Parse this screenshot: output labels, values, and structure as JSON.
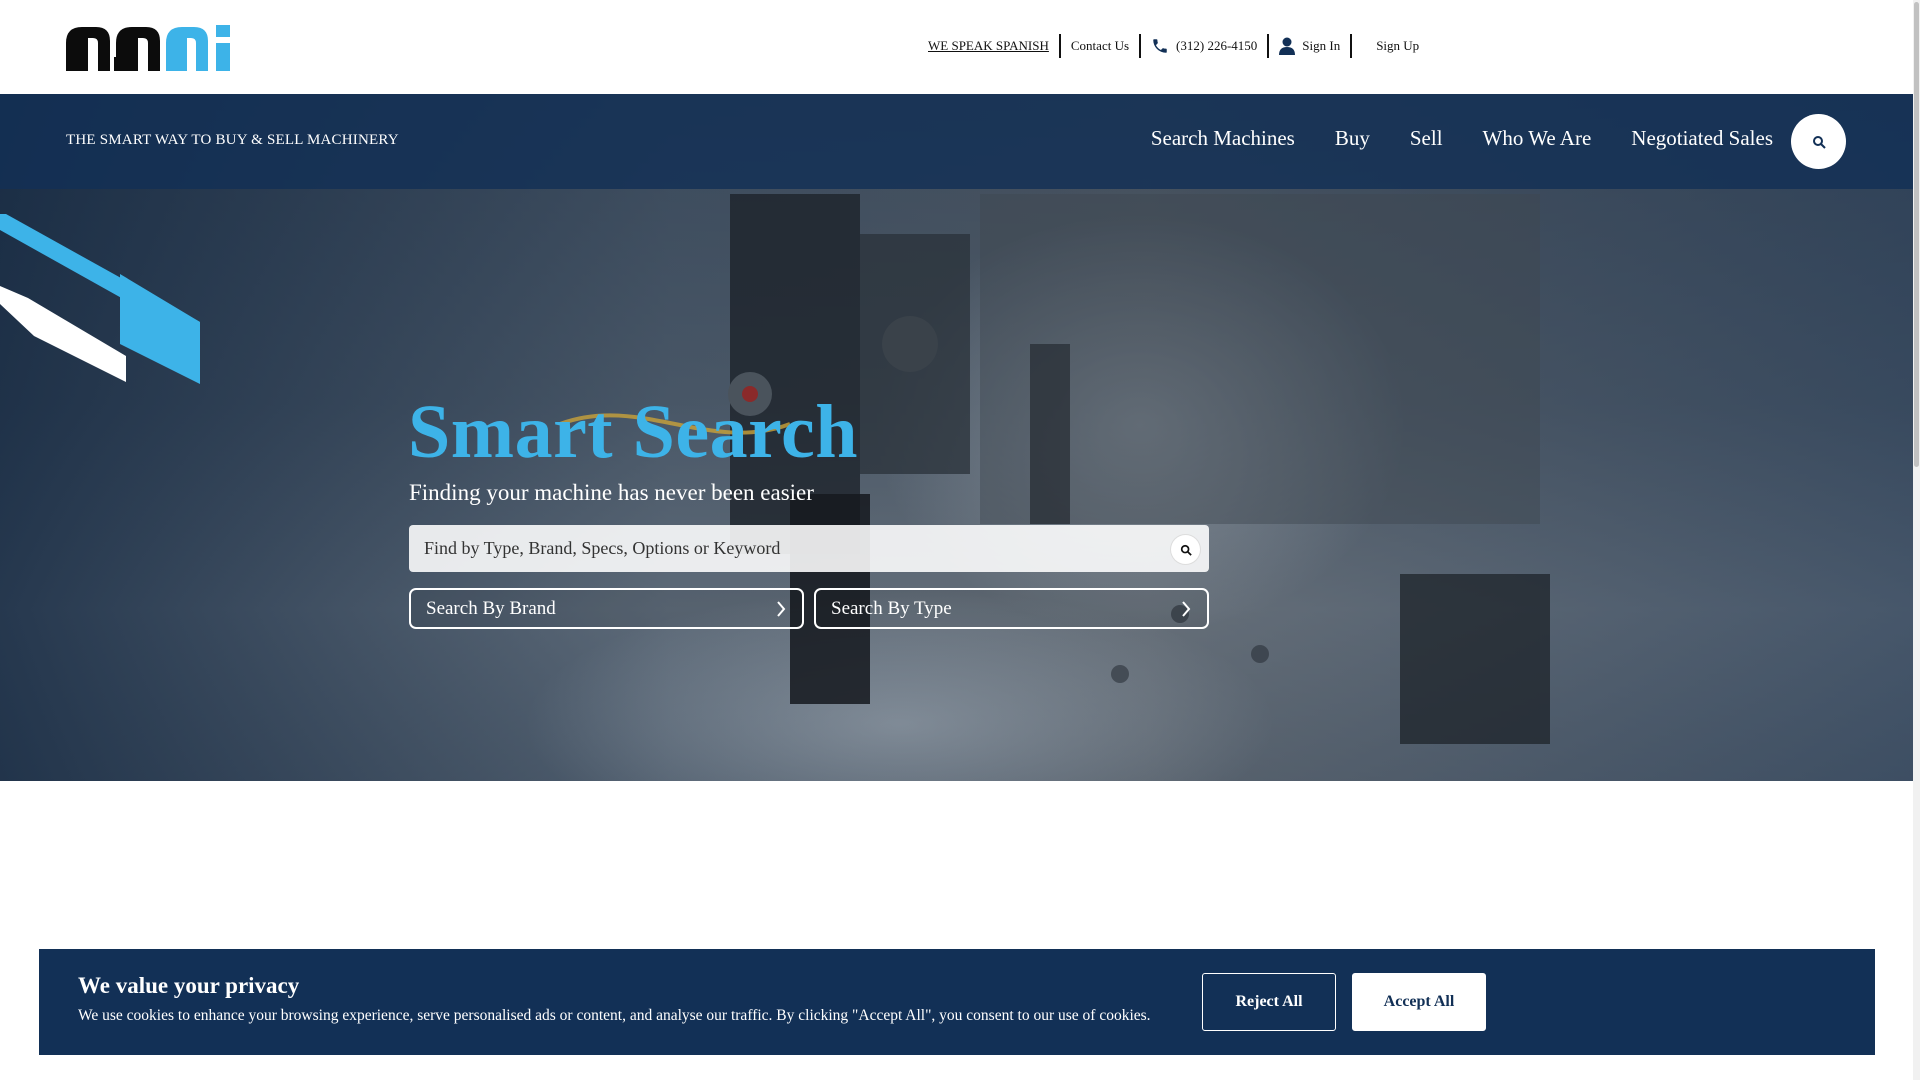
{
  "header": {
    "logo_name": "mmi-logo",
    "utility": {
      "spanish": "WE SPEAK SPANISH",
      "contact": "Contact Us",
      "phone": "(312) 226-4150",
      "sign_in": "Sign In",
      "sign_up": "Sign Up"
    }
  },
  "nav": {
    "tagline": "THE SMART WAY TO BUY & SELL MACHINERY",
    "items": [
      "Search Machines",
      "Buy",
      "Sell",
      "Who We Are",
      "Negotiated Sales"
    ],
    "search_icon": "search-icon"
  },
  "hero": {
    "title_word1": "Smart",
    "title_word2": "Search",
    "subtitle": "Finding your machine has never been easier",
    "search_placeholder": "Find by Type, Brand, Specs, Options or Keyword",
    "brand_button": "Search By Brand",
    "type_button": "Search By Type"
  },
  "cookie": {
    "title": "We value your privacy",
    "text": "We use cookies to enhance your browsing experience, serve personalised ads or content, and analyse our traffic. By clicking \"Accept All\", you consent to our use of cookies.",
    "reject": "Reject All",
    "accept": "Accept All"
  },
  "colors": {
    "brand_navy": "#123056",
    "accent_blue": "#3db3e8"
  }
}
